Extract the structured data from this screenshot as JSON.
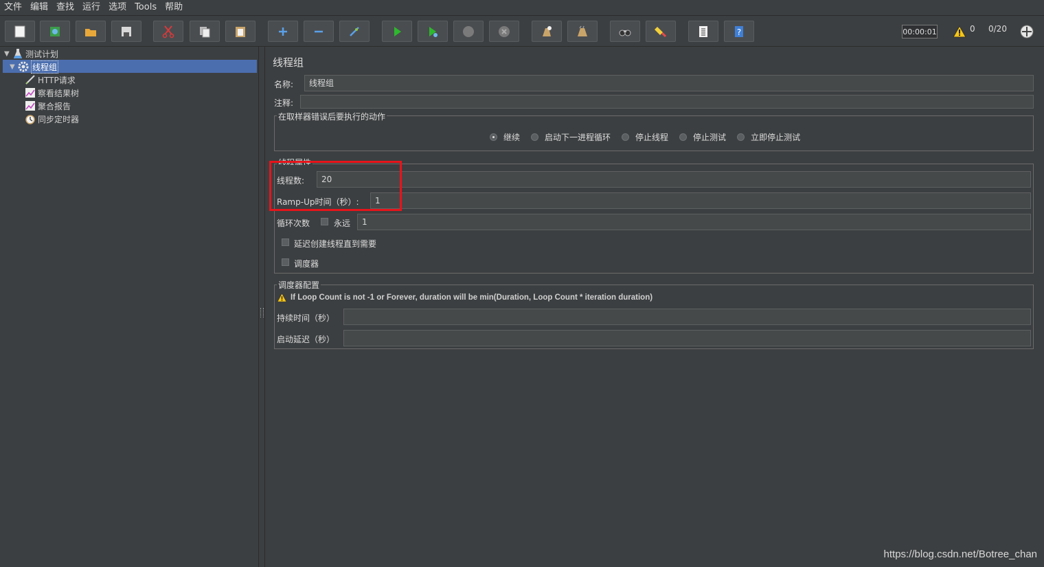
{
  "menu": [
    "文件",
    "编辑",
    "查找",
    "运行",
    "选项",
    "Tools",
    "帮助"
  ],
  "toolbar": {
    "buttons": [
      {
        "name": "new-icon"
      },
      {
        "name": "templates-icon"
      },
      {
        "name": "open-icon"
      },
      {
        "name": "save-icon"
      },
      {
        "name": "cut-icon"
      },
      {
        "name": "copy-icon"
      },
      {
        "name": "paste-icon"
      },
      {
        "name": "expand-icon"
      },
      {
        "name": "collapse-icon"
      },
      {
        "name": "toggle-icon"
      },
      {
        "name": "start-icon"
      },
      {
        "name": "start-no-pause-icon"
      },
      {
        "name": "stop-icon"
      },
      {
        "name": "shutdown-icon"
      },
      {
        "name": "clear-icon"
      },
      {
        "name": "clear-all-icon"
      },
      {
        "name": "search-icon"
      },
      {
        "name": "reset-search-icon"
      },
      {
        "name": "function-helper-icon"
      },
      {
        "name": "help-icon"
      }
    ],
    "timer": "00:00:01",
    "warning_count": "0",
    "threads": "0/20"
  },
  "tree": {
    "items": [
      {
        "label": "测试计划",
        "icon": "test-plan-icon"
      },
      {
        "label": "线程组",
        "icon": "gear-icon"
      },
      {
        "label": "HTTP请求",
        "icon": "sampler-icon"
      },
      {
        "label": "察看结果树",
        "icon": "listener-icon"
      },
      {
        "label": "聚合报告",
        "icon": "listener-icon"
      },
      {
        "label": "同步定时器",
        "icon": "timer-icon"
      }
    ]
  },
  "form": {
    "title": "线程组",
    "name_label": "名称:",
    "name_value": "线程组",
    "comment_label": "注释:",
    "comment_value": "",
    "error_action": {
      "legend": "在取样器错误后要执行的动作",
      "options": [
        "继续",
        "启动下一进程循环",
        "停止线程",
        "停止测试",
        "立即停止测试"
      ],
      "selected": "继续"
    },
    "thread_props": {
      "legend": "线程属性",
      "threads_label": "线程数:",
      "threads_value": "20",
      "rampup_label": "Ramp-Up时间（秒）:",
      "rampup_value": "1",
      "loop_label": "循环次数",
      "forever_label": "永远",
      "loop_value": "1",
      "delay_label": "延迟创建线程直到需要",
      "scheduler_label": "调度器"
    },
    "scheduler": {
      "legend": "调度器配置",
      "warning": "If Loop Count is not -1 or Forever, duration will be min(Duration, Loop Count * iteration duration)",
      "duration_label": "持续时间（秒）",
      "duration_value": "",
      "delay_label": "启动延迟（秒）",
      "delay_value": ""
    }
  },
  "watermark": "https://blog.csdn.net/Botree_chan",
  "colors": {
    "background": "#3c3f41",
    "selection": "#4b6eaf",
    "highlight": "#e8141b"
  }
}
